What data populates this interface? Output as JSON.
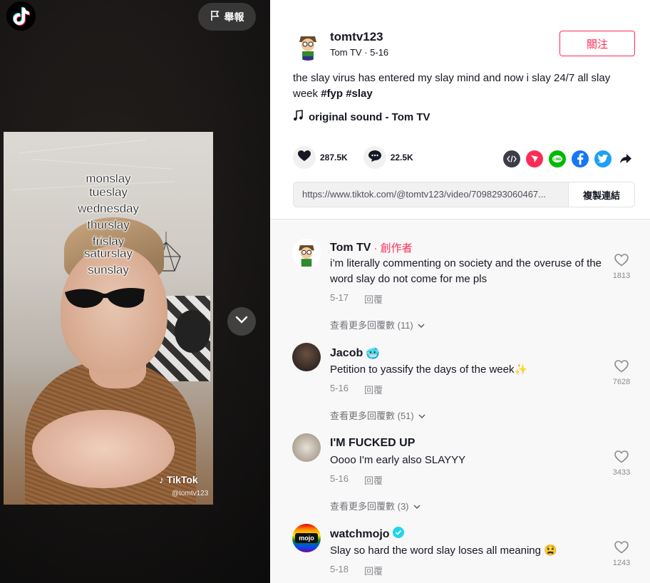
{
  "report": {
    "label": "舉報"
  },
  "video": {
    "overlay_lines": [
      "monslay",
      "tueslay",
      "wednesday",
      "thurslay",
      "frislay",
      "saturslay",
      "sunslay"
    ],
    "watermark_brand": "TikTok",
    "watermark_handle": "@tomtv123"
  },
  "post": {
    "username": "tomtv123",
    "display_name": "Tom TV",
    "date": "5-16",
    "follow_label": "關注",
    "caption_text": "the slay virus has entered my slay mind and now i slay 24/7 all slay week ",
    "hashtags": [
      "#fyp",
      "#slay"
    ],
    "music": "original sound - Tom TV",
    "likes": "287.5K",
    "comments_count": "22.5K",
    "share_url": "https://www.tiktok.com/@tomtv123/video/7098293060467...",
    "copy_label": "複製連結"
  },
  "comments": [
    {
      "name": "Tom TV",
      "creator_tag": "· 創作者",
      "text": "i’m literally commenting on society and the overuse of the word slay do not come for me pls",
      "date": "5-17",
      "reply": "回覆",
      "likes": "1813",
      "more": "查看更多回覆數 (11)"
    },
    {
      "name": "Jacob",
      "name_emoji": "🥶",
      "text": "Petition to yassify the days of the week✨",
      "date": "5-16",
      "reply": "回覆",
      "likes": "7628",
      "more": "查看更多回覆數 (51)"
    },
    {
      "name": "I'M FUCKED UP",
      "text": "Oooo I'm early also SLAYYY",
      "date": "5-16",
      "reply": "回覆",
      "likes": "3433",
      "more": "查看更多回覆數 (3)"
    },
    {
      "name": "watchmojo",
      "text": "Slay so hard the word slay loses all meaning 😫",
      "date": "5-18",
      "reply": "回覆",
      "likes": "1243"
    }
  ],
  "colors": {
    "accent": "#fe2c55",
    "text": "#161823"
  }
}
